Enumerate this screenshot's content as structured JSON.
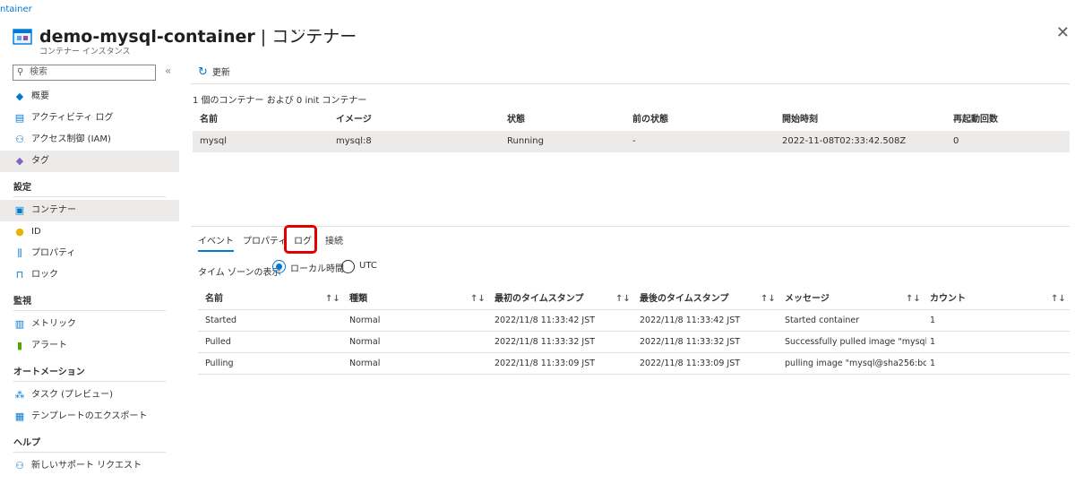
{
  "breadcrumb": "ntainer",
  "header": {
    "title": "demo-mysql-container",
    "title_sep": " | ",
    "title_suffix": "コンテナー",
    "subtitle": "コンテナー インスタンス",
    "more": "···",
    "close": "✕"
  },
  "sidebar": {
    "search_placeholder": "検索",
    "collapse": "«",
    "items": [
      {
        "label": "概要",
        "icon": "cloud-icon"
      },
      {
        "label": "アクティビティ ログ",
        "icon": "log-icon"
      },
      {
        "label": "アクセス制御 (IAM)",
        "icon": "people-icon"
      },
      {
        "label": "タグ",
        "icon": "tag-icon"
      }
    ],
    "group_settings": "設定",
    "settings_items": [
      {
        "label": "コンテナー",
        "icon": "container-icon"
      },
      {
        "label": "ID",
        "icon": "key-icon"
      },
      {
        "label": "プロパティ",
        "icon": "properties-icon"
      },
      {
        "label": "ロック",
        "icon": "lock-icon"
      }
    ],
    "group_monitoring": "監視",
    "monitoring_items": [
      {
        "label": "メトリック",
        "icon": "metrics-icon"
      },
      {
        "label": "アラート",
        "icon": "alert-icon"
      }
    ],
    "group_automation": "オートメーション",
    "automation_items": [
      {
        "label": "タスク (プレビュー)",
        "icon": "tasks-icon"
      },
      {
        "label": "テンプレートのエクスポート",
        "icon": "export-icon"
      }
    ],
    "group_help": "ヘルプ",
    "help_items": [
      {
        "label": "新しいサポート リクエスト",
        "icon": "support-icon"
      }
    ]
  },
  "toolbar": {
    "refresh_label": "更新"
  },
  "containers": {
    "count_text": "1 個のコンテナー および 0 init コンテナー",
    "headers": [
      "名前",
      "イメージ",
      "状態",
      "前の状態",
      "開始時刻",
      "再起動回数"
    ],
    "rows": [
      [
        "mysql",
        "mysql:8",
        "Running",
        "-",
        "2022-11-08T02:33:42.508Z",
        "0"
      ]
    ]
  },
  "tabs": [
    "イベント",
    "プロパティ",
    "ログ",
    "接続"
  ],
  "timezone": {
    "label": "タイム ゾーンの表示",
    "option_local": "ローカル時間",
    "option_utc": "UTC",
    "selected": "ローカル時間"
  },
  "events": {
    "headers": [
      "名前",
      "種類",
      "最初のタイムスタンプ",
      "最後のタイムスタンプ",
      "メッセージ",
      "カウント"
    ],
    "sort_icon": "↑↓",
    "rows": [
      [
        "Started",
        "Normal",
        "2022/11/8 11:33:42 JST",
        "2022/11/8 11:33:42 JST",
        "Started container",
        "1"
      ],
      [
        "Pulled",
        "Normal",
        "2022/11/8 11:33:32 JST",
        "2022/11/8 11:33:32 JST",
        "Successfully pulled image \"mysql...",
        "1"
      ],
      [
        "Pulling",
        "Normal",
        "2022/11/8 11:33:09 JST",
        "2022/11/8 11:33:09 JST",
        "pulling image \"mysql@sha256:bd...",
        "1"
      ]
    ]
  },
  "colors": {
    "accent": "#0078d4",
    "highlight": "#e00000",
    "selected_row": "#edebe9"
  }
}
